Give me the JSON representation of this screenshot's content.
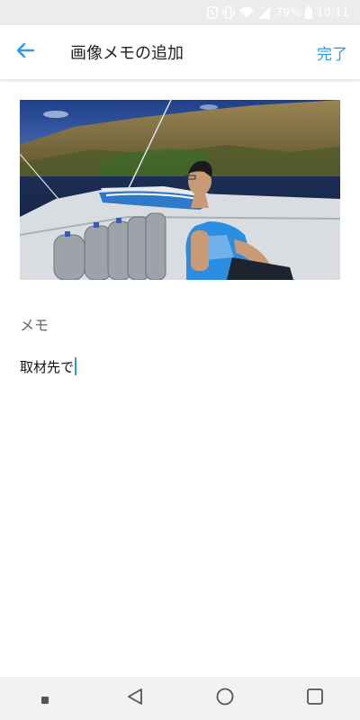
{
  "status_bar": {
    "battery_text": "79%",
    "time": "10:11",
    "icons": [
      "nfc-icon",
      "vibrate-icon",
      "wifi-icon",
      "signal-icon",
      "battery-icon"
    ]
  },
  "app_bar": {
    "back_icon": "arrow-back-icon",
    "title": "画像メモの追加",
    "done_label": "完了"
  },
  "photo": {
    "description_icon": "photo"
  },
  "memo": {
    "label": "メモ",
    "value": "取材先で"
  },
  "nav_bar": {
    "icons": [
      "recent-dot-icon",
      "back-triangle-icon",
      "home-circle-icon",
      "overview-square-icon"
    ]
  },
  "colors": {
    "accent": "#2b9be0",
    "status_bar_bg": "#ececec",
    "nav_bar_bg": "#f2f2f2"
  }
}
